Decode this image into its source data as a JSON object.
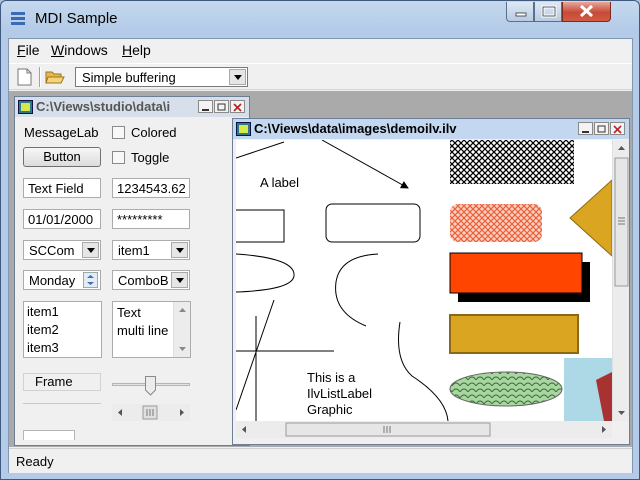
{
  "app": {
    "title": "MDI Sample"
  },
  "menu": {
    "file": "File",
    "windows": "Windows",
    "help": "Help"
  },
  "toolbar": {
    "buffering": "Simple buffering"
  },
  "status": {
    "text": "Ready"
  },
  "child_gadgets": {
    "title": "C:\\Views\\studio\\data\\i",
    "message_label": "MessageLab",
    "colored_label": "Colored",
    "button_label": "Button",
    "toggle_label": "Toggle",
    "text_field": "Text Field",
    "number_field": "1234543.62",
    "date_field": "01/01/2000",
    "password_field": "*********",
    "sccombo": "SCCom",
    "combo_item": "item1",
    "spinner_value": "Monday",
    "combo_box": "ComboB",
    "list_items": [
      "item1",
      "item2",
      "item3"
    ],
    "multiline_text": [
      "Text",
      "multi line"
    ],
    "frame_label": "Frame"
  },
  "child_graphics": {
    "title": "C:\\Views\\data\\images\\demoilv.ilv",
    "a_label": "A label",
    "list_label_lines": [
      "This is a",
      "IlvListLabel",
      "Graphic"
    ]
  },
  "colors": {
    "titlebar": "#c5d8ee",
    "red_rect": "#ff4500",
    "gold": "#daa520",
    "ellipse_green": "#8fbc8f",
    "lightblue": "#add8e6"
  }
}
